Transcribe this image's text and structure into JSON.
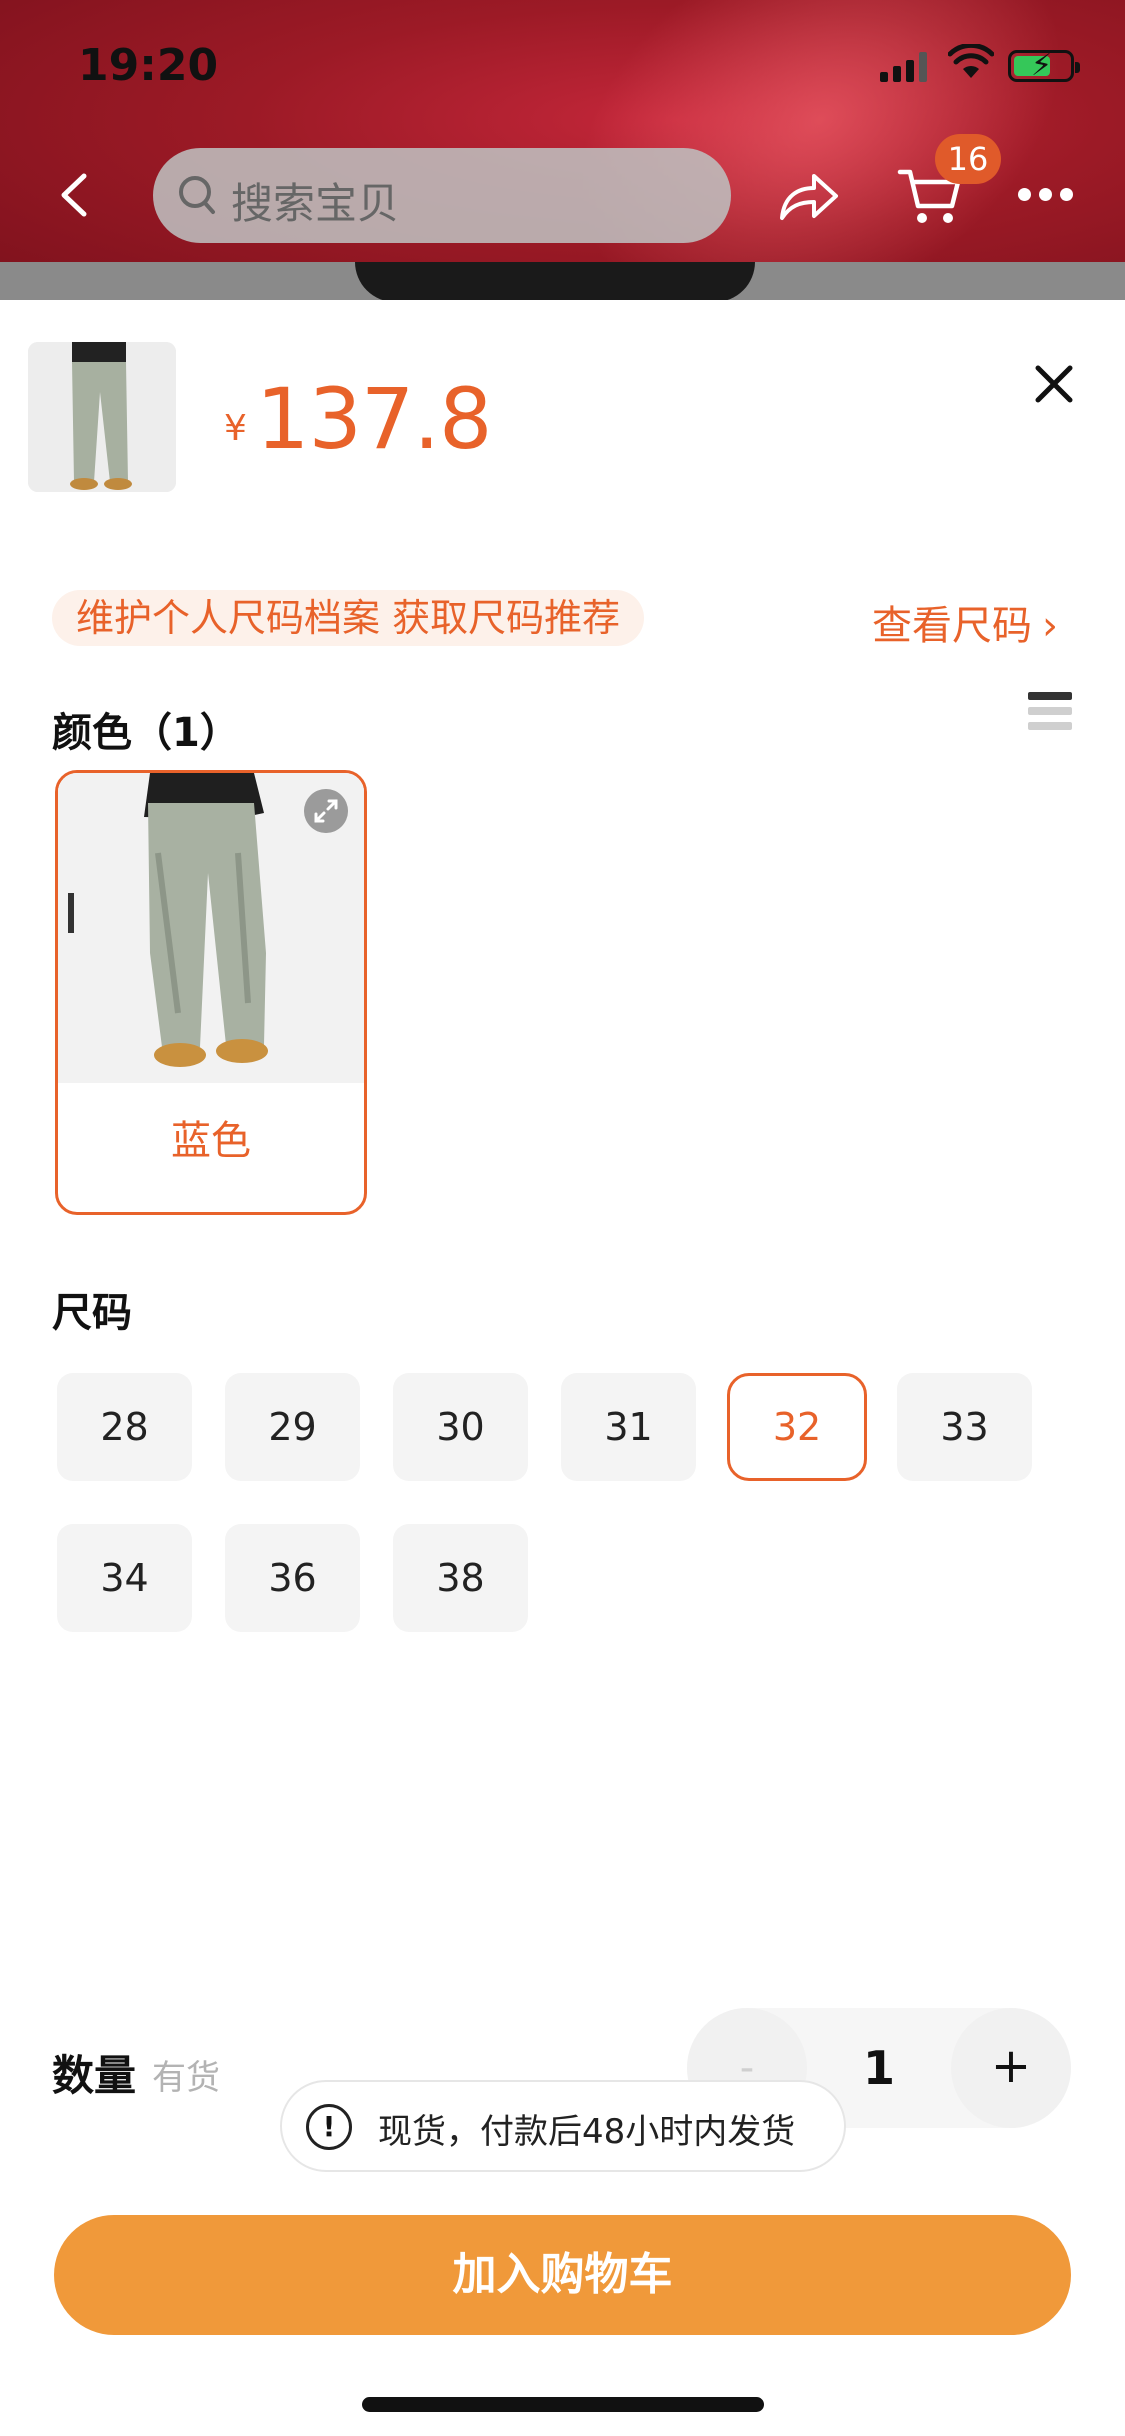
{
  "status_bar": {
    "time": "19:20"
  },
  "header": {
    "search_placeholder": "搜索宝贝",
    "cart_badge": "16"
  },
  "product": {
    "currency_symbol": "¥",
    "price": "137.8"
  },
  "size_tip": {
    "text": "维护个人尺码档案 获取尺码推荐",
    "link_label": "查看尺码"
  },
  "color_section": {
    "label": "颜色（1）",
    "options": [
      {
        "name": "蓝色",
        "selected": true
      }
    ]
  },
  "size_section": {
    "label": "尺码",
    "options": [
      "28",
      "29",
      "30",
      "31",
      "32",
      "33",
      "34",
      "36",
      "38"
    ],
    "selected": "32"
  },
  "quantity": {
    "label": "数量",
    "stock_status": "有货",
    "value": "1",
    "minus": "-",
    "plus": "+"
  },
  "shipping_note": "现货，付款后48小时内发货",
  "add_to_cart_label": "加入购物车",
  "colors": {
    "accent": "#e8622a",
    "cta": "#f0993a",
    "header_red": "#9c1a26"
  }
}
